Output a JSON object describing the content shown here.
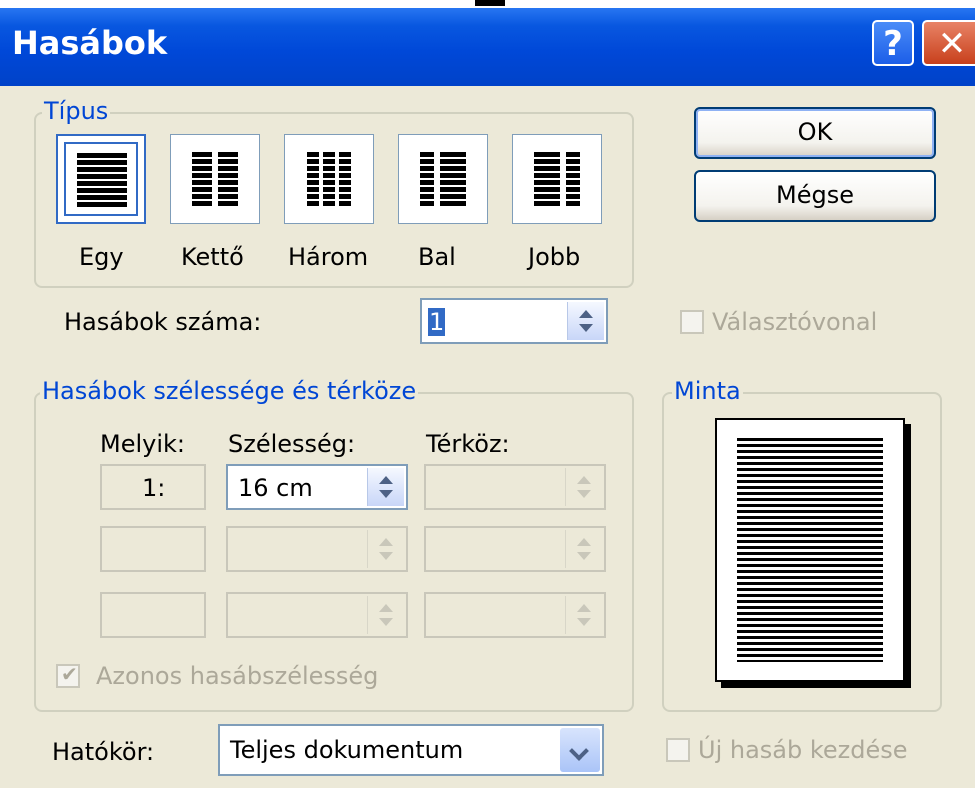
{
  "dialog": {
    "title": "Hasábok",
    "help_glyph": "?",
    "close_glyph": "✕"
  },
  "tipus": {
    "group_label": "Típus",
    "presets": [
      {
        "label": "Egy",
        "underline": "E",
        "icon": "one-column-icon",
        "selected": true
      },
      {
        "label": "Kettő",
        "underline": "K",
        "icon": "two-columns-icon",
        "selected": false
      },
      {
        "label": "Három",
        "underline": "H",
        "icon": "three-columns-icon",
        "selected": false
      },
      {
        "label": "Bal",
        "underline": "B",
        "icon": "left-column-icon",
        "selected": false
      },
      {
        "label": "Jobb",
        "underline": "J",
        "icon": "right-column-icon",
        "selected": false
      }
    ]
  },
  "buttons": {
    "ok": "OK",
    "cancel": "Mégse"
  },
  "columns_count": {
    "label": "Hasábok száma:",
    "value": "1"
  },
  "line_between": {
    "label": "Választóvonal",
    "checked": false,
    "enabled": false
  },
  "width_spacing": {
    "group_label": "Hasábok szélessége és térköze",
    "headers": {
      "which": "Melyik:",
      "width": "Szélesség:",
      "spacing": "Térköz:"
    },
    "rows": [
      {
        "which": "1:",
        "width": "16 cm",
        "spacing": ""
      },
      {
        "which": "",
        "width": "",
        "spacing": ""
      },
      {
        "which": "",
        "width": "",
        "spacing": ""
      }
    ],
    "equal_width": {
      "label": "Azonos hasábszélesség",
      "checked": true,
      "enabled": false
    }
  },
  "preview": {
    "group_label": "Minta"
  },
  "apply_to": {
    "label": "Hatókör:",
    "value": "Teljes dokumentum"
  },
  "start_new_column": {
    "label": "Új hasáb kezdése",
    "checked": false,
    "enabled": false
  }
}
